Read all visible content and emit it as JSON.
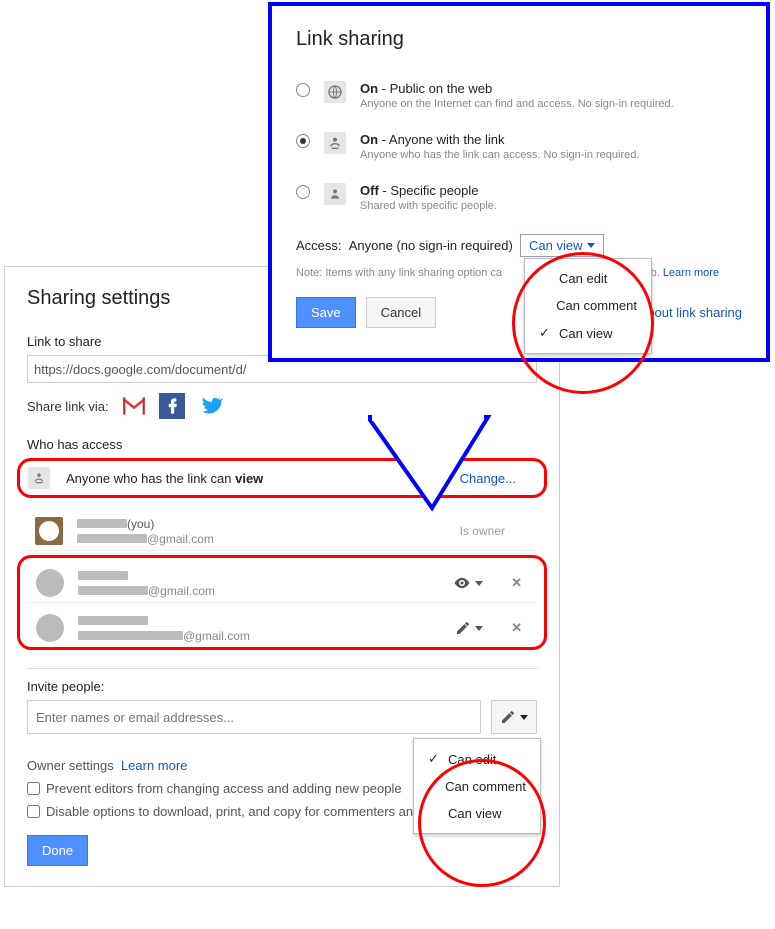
{
  "sharing": {
    "title": "Sharing settings",
    "link_label": "Link to share",
    "link_value": "https://docs.google.com/document/d/",
    "share_via": "Share link via:",
    "who_has_access": "Who has access",
    "link_access_prefix": "Anyone who has the link can ",
    "link_access_mode": "view",
    "change": "Change...",
    "users": [
      {
        "you_suffix": "(you)",
        "email_suffix": "@gmail.com",
        "role": "Is owner"
      },
      {
        "email_suffix": "@gmail.com"
      },
      {
        "email_suffix": "@gmail.com"
      }
    ],
    "invite_label": "Invite people:",
    "invite_placeholder": "Enter names or email addresses...",
    "invite_menu": {
      "edit": "Can edit",
      "comment": "Can comment",
      "view": "Can view"
    },
    "owner_settings": "Owner settings",
    "learn_more": "Learn more",
    "opt1": "Prevent editors from changing access and adding new people",
    "opt2": "Disable options to download, print, and copy for commenters and viewers",
    "done": "Done"
  },
  "popup": {
    "title": "Link sharing",
    "options": [
      {
        "title_b": "On",
        "title_rest": " - Public on the web",
        "desc": "Anyone on the Internet can find and access. No sign-in required."
      },
      {
        "title_b": "On",
        "title_rest": " - Anyone with the link",
        "desc": "Anyone who has the link can access. No sign-in required."
      },
      {
        "title_b": "Off",
        "title_rest": " - Specific people",
        "desc": "Shared with specific people."
      }
    ],
    "access_label": "Access:",
    "access_who": "Anyone (no sign-in required)",
    "access_dd": "Can view",
    "access_menu": {
      "edit": "Can edit",
      "comment": "Can comment",
      "view": "Can view"
    },
    "note_prefix": "Note: Items with any link sharing option ca",
    "note_suffix": "the web. ",
    "learn_more": "Learn more",
    "save": "Save",
    "cancel": "Cancel",
    "learn_about": "about link sharing"
  }
}
